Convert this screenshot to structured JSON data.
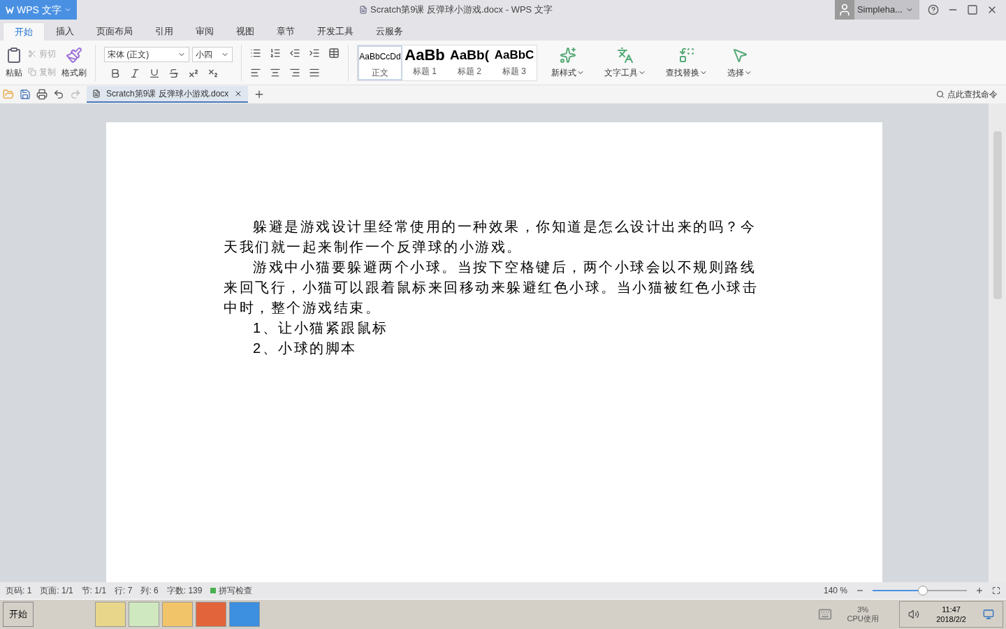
{
  "app_menu": {
    "label": "WPS 文字"
  },
  "window": {
    "title": "Scratch第9课 反弹球小游戏.docx - WPS 文字"
  },
  "user": {
    "name": "Simpleha..."
  },
  "ribbon_tabs": [
    {
      "label": "开始",
      "selected": true
    },
    {
      "label": "插入",
      "selected": false
    },
    {
      "label": "页面布局",
      "selected": false
    },
    {
      "label": "引用",
      "selected": false
    },
    {
      "label": "审阅",
      "selected": false
    },
    {
      "label": "视图",
      "selected": false
    },
    {
      "label": "章节",
      "selected": false
    },
    {
      "label": "开发工具",
      "selected": false
    },
    {
      "label": "云服务",
      "selected": false
    }
  ],
  "clipboard": {
    "paste": "粘贴",
    "cut": {
      "label": "剪切",
      "disabled": true
    },
    "copy": {
      "label": "复制",
      "disabled": true
    },
    "format_painter": "格式刷"
  },
  "font": {
    "name": "宋体 (正文)",
    "size": "小四"
  },
  "styles": [
    {
      "preview": "AaBbCcDd",
      "label": "正文",
      "selected": true,
      "kind": "body"
    },
    {
      "preview": "AaBb",
      "label": "标题 1",
      "selected": false,
      "kind": "h1"
    },
    {
      "preview": "AaBb(",
      "label": "标题 2",
      "selected": false,
      "kind": "h2"
    },
    {
      "preview": "AaBbC",
      "label": "标题 3",
      "selected": false,
      "kind": "h3"
    }
  ],
  "tools": [
    {
      "label": "新样式",
      "kind": "style"
    },
    {
      "label": "文字工具",
      "kind": "text"
    },
    {
      "label": "查找替换",
      "kind": "find"
    },
    {
      "label": "选择",
      "kind": "select"
    }
  ],
  "doc_tabs": [
    {
      "label": "Scratch第9课 反弹球小游戏.docx",
      "selected": true
    }
  ],
  "command_search": {
    "placeholder": "点此查找命令"
  },
  "document": {
    "paragraphs": [
      "躲避是游戏设计里经常使用的一种效果，你知道是怎么设计出来的吗？今天我们就一起来制作一个反弹球的小游戏。",
      "游戏中小猫要躲避两个小球。当按下空格键后，两个小球会以不规则路线来回飞行，小猫可以跟着鼠标来回移动来躲避红色小球。当小猫被红色小球击中时，整个游戏结束。",
      "1、让小猫紧跟鼠标",
      "2、小球的脚本"
    ]
  },
  "status_bar": {
    "items": [
      "页码: 1",
      "页面: 1/1",
      "节: 1/1",
      "行: 7",
      "列: 6",
      "字数: 139"
    ],
    "spell_check": "拼写检查"
  },
  "zoom": {
    "reading": "140 %",
    "level": 0.53
  },
  "taskbar": {
    "start": "开始",
    "cpu_value": "3%",
    "cpu_label": "CPU使用",
    "time": "11:47",
    "date": "2018/2/2"
  }
}
